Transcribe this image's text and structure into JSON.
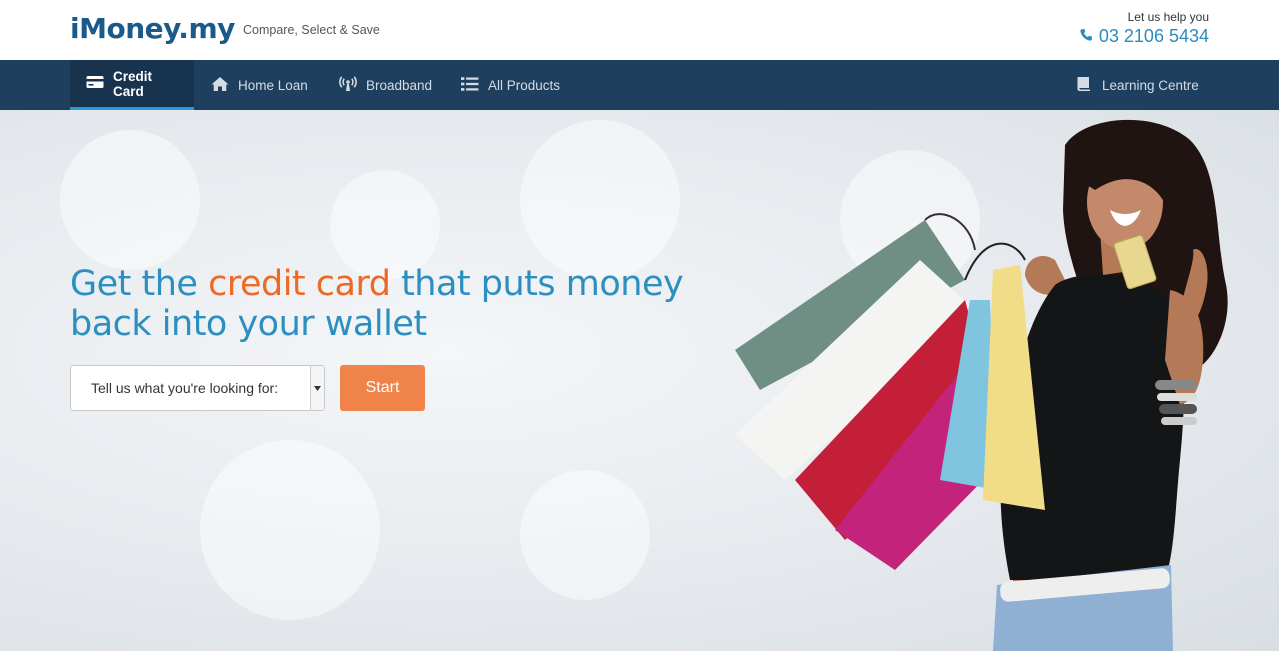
{
  "header": {
    "logo_text": "iMoney.my",
    "tagline": "Compare, Select & Save",
    "help_label": "Let us help you",
    "phone": "03 2106 5434"
  },
  "nav": {
    "items": [
      {
        "label": "Credit Card",
        "icon": "credit-card-icon",
        "active": true
      },
      {
        "label": "Home Loan",
        "icon": "home-icon",
        "active": false
      },
      {
        "label": "Broadband",
        "icon": "broadcast-icon",
        "active": false
      },
      {
        "label": "All Products",
        "icon": "list-icon",
        "active": false
      }
    ],
    "right_item": {
      "label": "Learning Centre",
      "icon": "book-icon"
    }
  },
  "hero": {
    "headline_part1": "Get the ",
    "headline_accent": "credit card",
    "headline_part2": " that puts money back into your wallet",
    "select_value": "Tell us what you're looking for:",
    "start_label": "Start"
  },
  "colors": {
    "brand_blue": "#2d8fbf",
    "nav_bg": "#1e3f5e",
    "accent_orange": "#ec6a26",
    "button_orange": "#f0834a"
  }
}
